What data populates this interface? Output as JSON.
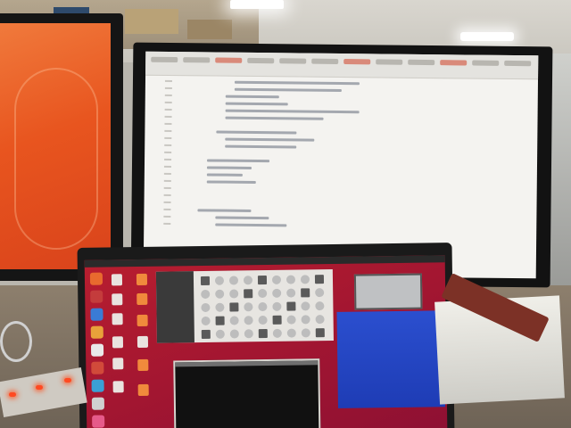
{
  "scene": {
    "description_tags": [
      "photo-icon",
      "monitor-icon",
      "laptop-icon"
    ],
    "colors": {
      "left_screen": "#e8551f",
      "center_screen": "#f4f3f0",
      "laptop_desktop": "#a31631",
      "laptop_blue_window": "#2b4fcf"
    }
  }
}
